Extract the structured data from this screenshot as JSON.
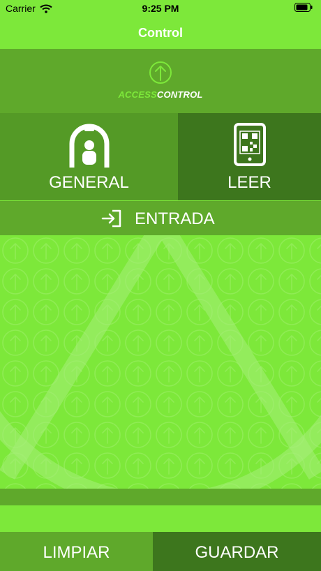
{
  "status_bar": {
    "carrier": "Carrier",
    "time": "9:25 PM"
  },
  "nav": {
    "title": "Control"
  },
  "brand": {
    "part1": "ACCESS",
    "part2": "CONTROL"
  },
  "modes": [
    {
      "label": "GENERAL",
      "icon": "person-badge-icon",
      "selected": false
    },
    {
      "label": "LEER",
      "icon": "tablet-qr-icon",
      "selected": true
    }
  ],
  "direction": {
    "label": "ENTRADA",
    "icon": "enter-icon"
  },
  "actions": {
    "clear_label": "LIMPIAR",
    "save_label": "GUARDAR"
  },
  "colors": {
    "primary": "#7de83a",
    "secondary": "#5fa92b",
    "dark": "#3d761d",
    "text": "#ffffff"
  }
}
